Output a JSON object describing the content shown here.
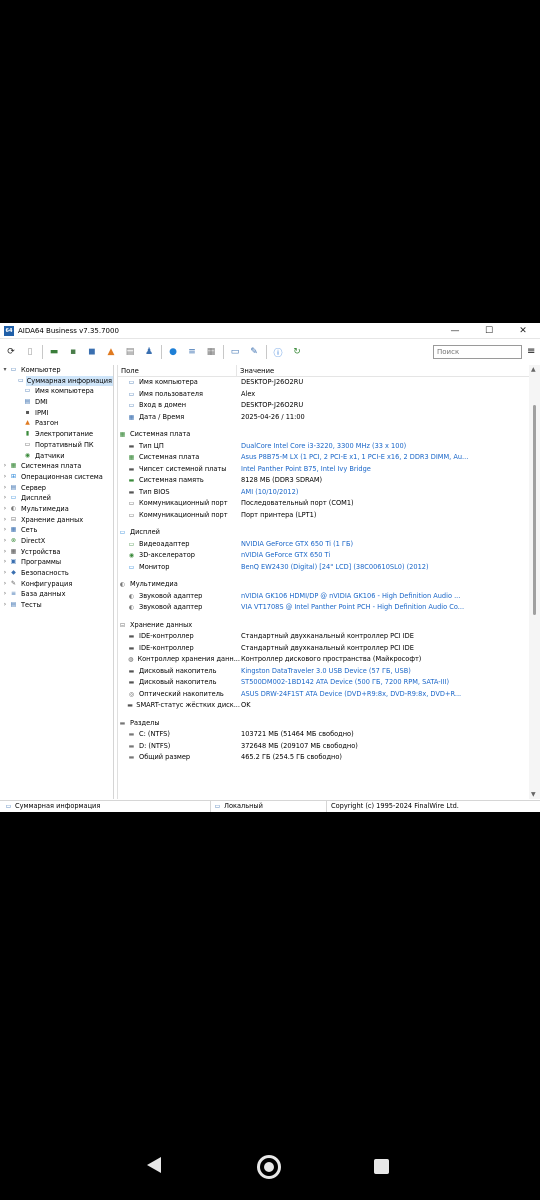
{
  "window": {
    "title": "AIDA64 Business v7.35.7000",
    "app_icon_text": "64",
    "controls": {
      "minimize": "—",
      "maximize": "☐",
      "close": "✕"
    }
  },
  "toolbar": {
    "search_placeholder": "Поиск",
    "menu_glyph": "≡",
    "buttons": [
      {
        "icon": "refresh-icon",
        "glyph": "⟳",
        "color": "#222"
      },
      {
        "icon": "report-icon",
        "glyph": "▯",
        "color": "#999"
      },
      {
        "icon": "memory-icon",
        "glyph": "▬",
        "color": "#3a7d3a"
      },
      {
        "icon": "chip-icon",
        "glyph": "▪",
        "color": "#4a7d4a"
      },
      {
        "icon": "cache-icon",
        "glyph": "◼",
        "color": "#3a6fb0"
      },
      {
        "icon": "benchmark-icon",
        "glyph": "▲",
        "color": "#e07a20"
      },
      {
        "icon": "disk-icon",
        "glyph": "▤",
        "color": "#7a7a7a"
      },
      {
        "icon": "user-icon",
        "glyph": "♟",
        "color": "#3a6fb0"
      },
      {
        "icon": "globe-icon",
        "glyph": "●",
        "color": "#1e7fd6"
      },
      {
        "icon": "database-icon",
        "glyph": "≡",
        "color": "#3a6fb0"
      },
      {
        "icon": "document-icon",
        "glyph": "▦",
        "color": "#777"
      },
      {
        "icon": "monitor-icon",
        "glyph": "▭",
        "color": "#3a6fb0"
      },
      {
        "icon": "wrench-icon",
        "glyph": "✎",
        "color": "#3a6fb0"
      },
      {
        "icon": "info-icon",
        "glyph": "ⓘ",
        "color": "#1e6fd6"
      },
      {
        "icon": "export-icon",
        "glyph": "↻",
        "color": "#3a8a3a"
      }
    ]
  },
  "sidebar": {
    "items": [
      {
        "label": "Компьютер",
        "expander": "▾",
        "indent": 0,
        "icon": "computer-icon",
        "glyph": "▭",
        "color": "#3a6fb0",
        "selected": false
      },
      {
        "label": "Суммарная информация",
        "expander": "",
        "indent": 1,
        "icon": "summary-icon",
        "glyph": "▭",
        "color": "#3a6fb0",
        "selected": true
      },
      {
        "label": "Имя компьютера",
        "expander": "",
        "indent": 1,
        "icon": "computer-name-icon",
        "glyph": "▭",
        "color": "#3a6fb0",
        "selected": false
      },
      {
        "label": "DMI",
        "expander": "",
        "indent": 1,
        "icon": "dmi-icon",
        "glyph": "▤",
        "color": "#3a6fb0",
        "selected": false
      },
      {
        "label": "IPMI",
        "expander": "",
        "indent": 1,
        "icon": "ipmi-icon",
        "glyph": "▪",
        "color": "#555",
        "selected": false
      },
      {
        "label": "Разгон",
        "expander": "",
        "indent": 1,
        "icon": "overclock-icon",
        "glyph": "▲",
        "color": "#e07a20",
        "selected": false
      },
      {
        "label": "Электропитание",
        "expander": "",
        "indent": 1,
        "icon": "power-icon",
        "glyph": "▮",
        "color": "#3a8a3a",
        "selected": false
      },
      {
        "label": "Портативный ПК",
        "expander": "",
        "indent": 1,
        "icon": "laptop-icon",
        "glyph": "▭",
        "color": "#555",
        "selected": false
      },
      {
        "label": "Датчики",
        "expander": "",
        "indent": 1,
        "icon": "sensor-icon",
        "glyph": "◉",
        "color": "#3a8a3a",
        "selected": false
      },
      {
        "label": "Системная плата",
        "expander": "›",
        "indent": 0,
        "icon": "motherboard-icon",
        "glyph": "▦",
        "color": "#3a8a3a",
        "selected": false
      },
      {
        "label": "Операционная система",
        "expander": "›",
        "indent": 0,
        "icon": "os-icon",
        "glyph": "⊞",
        "color": "#1e7fd6",
        "selected": false
      },
      {
        "label": "Сервер",
        "expander": "›",
        "indent": 0,
        "icon": "server-icon",
        "glyph": "▤",
        "color": "#3a6fb0",
        "selected": false
      },
      {
        "label": "Дисплей",
        "expander": "›",
        "indent": 0,
        "icon": "display-icon",
        "glyph": "▭",
        "color": "#1e7fd6",
        "selected": false
      },
      {
        "label": "Мультимедиа",
        "expander": "›",
        "indent": 0,
        "icon": "multimedia-icon",
        "glyph": "◐",
        "color": "#777",
        "selected": false
      },
      {
        "label": "Хранение данных",
        "expander": "›",
        "indent": 0,
        "icon": "storage-icon",
        "glyph": "⊟",
        "color": "#777",
        "selected": false
      },
      {
        "label": "Сеть",
        "expander": "›",
        "indent": 0,
        "icon": "network-icon",
        "glyph": "▦",
        "color": "#3a6fb0",
        "selected": false
      },
      {
        "label": "DirectX",
        "expander": "›",
        "indent": 0,
        "icon": "directx-icon",
        "glyph": "⊗",
        "color": "#3a8a3a",
        "selected": false
      },
      {
        "label": "Устройства",
        "expander": "›",
        "indent": 0,
        "icon": "devices-icon",
        "glyph": "▦",
        "color": "#555",
        "selected": false
      },
      {
        "label": "Программы",
        "expander": "›",
        "indent": 0,
        "icon": "programs-icon",
        "glyph": "▣",
        "color": "#3a6fb0",
        "selected": false
      },
      {
        "label": "Безопасность",
        "expander": "›",
        "indent": 0,
        "icon": "security-icon",
        "glyph": "◆",
        "color": "#3a6fb0",
        "selected": false
      },
      {
        "label": "Конфигурация",
        "expander": "›",
        "indent": 0,
        "icon": "config-icon",
        "glyph": "✎",
        "color": "#555",
        "selected": false
      },
      {
        "label": "База данных",
        "expander": "›",
        "indent": 0,
        "icon": "database-icon",
        "glyph": "≡",
        "color": "#3a6fb0",
        "selected": false
      },
      {
        "label": "Тесты",
        "expander": "›",
        "indent": 0,
        "icon": "tests-icon",
        "glyph": "▤",
        "color": "#3a6fb0",
        "selected": false
      }
    ]
  },
  "table": {
    "col_field": "Поле",
    "col_value": "Значение",
    "rows": [
      {
        "type": "item",
        "field": "Имя компьютера",
        "value": "DESKTOP-J26O2RU",
        "link": false,
        "icon": "computer-icon",
        "glyph": "▭",
        "color": "#3a6fb0"
      },
      {
        "type": "item",
        "field": "Имя пользователя",
        "value": "Alex",
        "link": false,
        "icon": "user-icon",
        "glyph": "▭",
        "color": "#3a6fb0"
      },
      {
        "type": "item",
        "field": "Вход в домен",
        "value": "DESKTOP-J26O2RU",
        "link": false,
        "icon": "domain-icon",
        "glyph": "▭",
        "color": "#3a6fb0"
      },
      {
        "type": "item",
        "field": "Дата / Время",
        "value": "2025-04-26 / 11:00",
        "link": false,
        "icon": "calendar-icon",
        "glyph": "▦",
        "color": "#3a6fb0"
      },
      {
        "type": "spacer"
      },
      {
        "type": "cat",
        "field": "Системная плата",
        "icon": "motherboard-icon",
        "glyph": "▦",
        "color": "#3a8a3a"
      },
      {
        "type": "item",
        "field": "Тип ЦП",
        "value": "DualCore Intel Core i3-3220, 3300 MHz (33 x 100)",
        "link": true,
        "icon": "cpu-icon",
        "glyph": "▬",
        "color": "#555"
      },
      {
        "type": "item",
        "field": "Системная плата",
        "value": "Asus P8B75-M LX  (1 PCI, 2 PCI-E x1, 1 PCI-E x16, 2 DDR3 DIMM, Au...",
        "link": true,
        "icon": "motherboard-icon",
        "glyph": "▦",
        "color": "#3a8a3a"
      },
      {
        "type": "item",
        "field": "Чипсет системной платы",
        "value": "Intel Panther Point B75, Intel Ivy Bridge",
        "link": true,
        "icon": "chipset-icon",
        "glyph": "▬",
        "color": "#555"
      },
      {
        "type": "item",
        "field": "Системная память",
        "value": "8128 МБ  (DDR3 SDRAM)",
        "link": false,
        "icon": "memory-icon",
        "glyph": "▬",
        "color": "#3a8a3a"
      },
      {
        "type": "item",
        "field": "Тип BIOS",
        "value": "AMI (10/10/2012)",
        "link": true,
        "icon": "bios-icon",
        "glyph": "▬",
        "color": "#555"
      },
      {
        "type": "item",
        "field": "Коммуникационный порт",
        "value": "Последовательный порт (COM1)",
        "link": false,
        "icon": "port-icon",
        "glyph": "▭",
        "color": "#555"
      },
      {
        "type": "item",
        "field": "Коммуникационный порт",
        "value": "Порт принтера (LPT1)",
        "link": false,
        "icon": "port-icon",
        "glyph": "▭",
        "color": "#555"
      },
      {
        "type": "spacer"
      },
      {
        "type": "cat",
        "field": "Дисплей",
        "icon": "display-icon",
        "glyph": "▭",
        "color": "#1e7fd6"
      },
      {
        "type": "item",
        "field": "Видеоадаптер",
        "value": "NVIDIA GeForce GTX 650 Ti  (1 ГБ)",
        "link": true,
        "icon": "gpu-icon",
        "glyph": "▭",
        "color": "#3a8a3a"
      },
      {
        "type": "item",
        "field": "3D-акселератор",
        "value": "nVIDIA GeForce GTX 650 Ti",
        "link": true,
        "icon": "accelerator-icon",
        "glyph": "◉",
        "color": "#3a8a3a"
      },
      {
        "type": "item",
        "field": "Монитор",
        "value": "BenQ EW2430 (Digital)  [24\" LCD]  (38C00610SL0)  (2012)",
        "link": true,
        "icon": "monitor-icon",
        "glyph": "▭",
        "color": "#1e7fd6"
      },
      {
        "type": "spacer"
      },
      {
        "type": "cat",
        "field": "Мультимедиа",
        "icon": "multimedia-icon",
        "glyph": "◐",
        "color": "#777"
      },
      {
        "type": "item",
        "field": "Звуковой адаптер",
        "value": "nVIDIA GK106 HDMI/DP @ nVIDIA GK106 - High Definition Audio ...",
        "link": true,
        "icon": "audio-icon",
        "glyph": "◐",
        "color": "#777"
      },
      {
        "type": "item",
        "field": "Звуковой адаптер",
        "value": "VIA VT1708S @ Intel Panther Point PCH - High Definition Audio Co...",
        "link": true,
        "icon": "audio-icon",
        "glyph": "◐",
        "color": "#777"
      },
      {
        "type": "spacer"
      },
      {
        "type": "cat",
        "field": "Хранение данных",
        "icon": "storage-icon",
        "glyph": "⊟",
        "color": "#777"
      },
      {
        "type": "item",
        "field": "IDE-контроллер",
        "value": "Стандартный двухканальный контроллер PCI IDE",
        "link": false,
        "icon": "ide-icon",
        "glyph": "▬",
        "color": "#555"
      },
      {
        "type": "item",
        "field": "IDE-контроллер",
        "value": "Стандартный двухканальный контроллер PCI IDE",
        "link": false,
        "icon": "ide-icon",
        "glyph": "▬",
        "color": "#555"
      },
      {
        "type": "item",
        "field": "Контроллер хранения данн...",
        "value": "Контроллер дискового пространства (Майкрософт)",
        "link": false,
        "icon": "storage-controller-icon",
        "glyph": "◍",
        "color": "#555"
      },
      {
        "type": "item",
        "field": "Дисковый накопитель",
        "value": "Kingston DataTraveler 3.0 USB Device  (57 ГБ, USB)",
        "link": true,
        "icon": "drive-icon",
        "glyph": "▬",
        "color": "#555"
      },
      {
        "type": "item",
        "field": "Дисковый накопитель",
        "value": "ST500DM002-1BD142 ATA Device  (500 ГБ, 7200 RPM, SATA-III)",
        "link": true,
        "icon": "drive-icon",
        "glyph": "▬",
        "color": "#555"
      },
      {
        "type": "item",
        "field": "Оптический накопитель",
        "value": "ASUS DRW-24F1ST ATA Device  (DVD+R9:8x, DVD-R9:8x, DVD+R...",
        "link": true,
        "icon": "optical-drive-icon",
        "glyph": "◎",
        "color": "#555"
      },
      {
        "type": "item",
        "field": "SMART-статус жёстких диск...",
        "value": "OK",
        "link": false,
        "icon": "smart-icon",
        "glyph": "▬",
        "color": "#555"
      },
      {
        "type": "spacer"
      },
      {
        "type": "cat",
        "field": "Разделы",
        "icon": "partition-icon",
        "glyph": "▬",
        "color": "#777"
      },
      {
        "type": "item",
        "field": "C: (NTFS)",
        "value": "103721 МБ (51464 МБ свободно)",
        "link": false,
        "icon": "partition-icon",
        "glyph": "▬",
        "color": "#777"
      },
      {
        "type": "item",
        "field": "D: (NTFS)",
        "value": "372648 МБ (209107 МБ свободно)",
        "link": false,
        "icon": "partition-icon",
        "glyph": "▬",
        "color": "#777"
      },
      {
        "type": "item",
        "field": "Общий размер",
        "value": "465.2 ГБ (254.5 ГБ свободно)",
        "link": false,
        "icon": "partition-icon",
        "glyph": "▬",
        "color": "#777"
      }
    ]
  },
  "statusbar": {
    "left": "Суммарная информация",
    "middle": "Локальный",
    "right": "Copyright (c) 1995-2024 FinalWire Ltd."
  }
}
